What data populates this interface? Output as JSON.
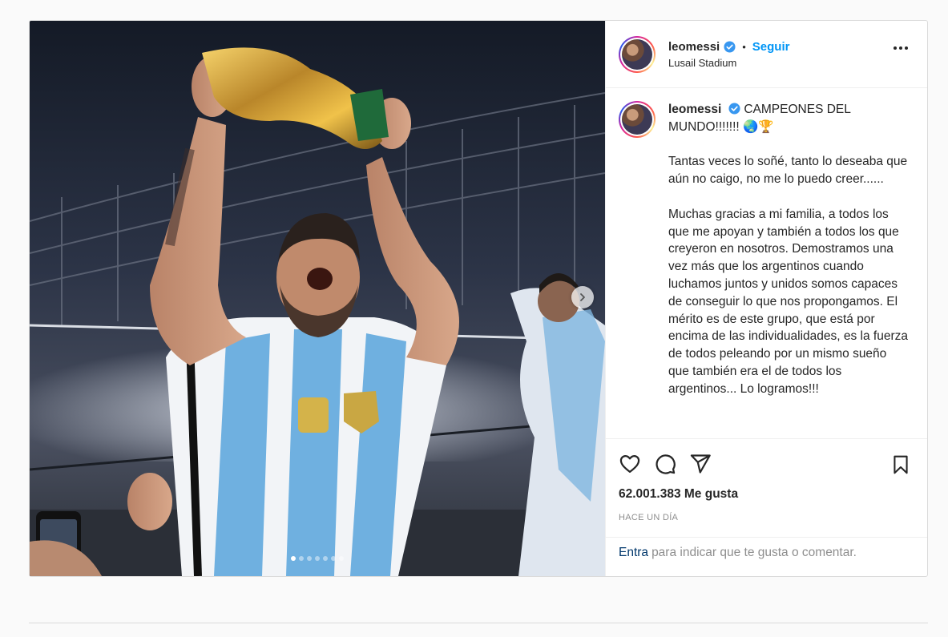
{
  "post": {
    "username": "leomessi",
    "follow_label": "Seguir",
    "separator": "•",
    "location": "Lusail Stadium",
    "caption_head": "CAMPEONES DEL MUNDO!!!!!!! 🌏🏆",
    "caption_paragraphs": [
      "Tantas veces lo soñé, tanto lo deseaba que aún no caigo, no me lo puedo creer......",
      "Muchas gracias a mi familia, a todos los que me apoyan y también a todos los que creyeron en nosotros. Demostramos una vez más que los argentinos cuando luchamos juntos y unidos somos capaces de conseguir lo que nos propongamos. El mérito es de este grupo, que está por encima de las individualidades, es la fuerza de todos peleando por un mismo sueño que también era el de todos los argentinos... Lo logramos!!!"
    ],
    "likes": "62.001.383 Me gusta",
    "timestamp": "HACE UN DÍA",
    "comment_link": "Entra",
    "comment_prompt": "para indicar que te gusta o comentar.",
    "carousel_count": 7,
    "carousel_active": 0
  },
  "icons": {
    "verified": "verified-badge-icon",
    "more": "more-options-icon",
    "like": "heart-icon",
    "comment": "comment-icon",
    "share": "share-icon",
    "save": "bookmark-icon",
    "next": "chevron-right-icon"
  },
  "colors": {
    "accent": "#0095f6",
    "verified": "#3897f0",
    "muted": "#8e8e8e"
  }
}
